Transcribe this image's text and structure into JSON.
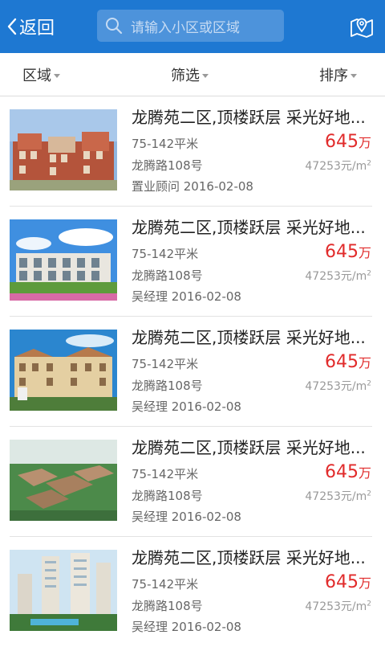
{
  "header": {
    "back_label": "返回",
    "search_placeholder": "请输入小区或区域"
  },
  "filters": [
    {
      "label": "区域"
    },
    {
      "label": "筛选"
    },
    {
      "label": "排序"
    }
  ],
  "listings": [
    {
      "title": "龙腾苑二区,顶楼跃层 采光好地...",
      "area": "75-142平米",
      "address": "龙腾路108号",
      "agent": "置业顾问 2016-02-08",
      "price": "645",
      "price_unit": "万",
      "unit_price": "47253元/m",
      "unit_price_sup": "2"
    },
    {
      "title": "龙腾苑二区,顶楼跃层 采光好地...",
      "area": "75-142平米",
      "address": "龙腾路108号",
      "agent": "吴经理 2016-02-08",
      "price": "645",
      "price_unit": "万",
      "unit_price": "47253元/m",
      "unit_price_sup": "2"
    },
    {
      "title": "龙腾苑二区,顶楼跃层 采光好地...",
      "area": "75-142平米",
      "address": "龙腾路108号",
      "agent": "吴经理 2016-02-08",
      "price": "645",
      "price_unit": "万",
      "unit_price": "47253元/m",
      "unit_price_sup": "2"
    },
    {
      "title": "龙腾苑二区,顶楼跃层 采光好地...",
      "area": "75-142平米",
      "address": "龙腾路108号",
      "agent": "吴经理 2016-02-08",
      "price": "645",
      "price_unit": "万",
      "unit_price": "47253元/m",
      "unit_price_sup": "2"
    },
    {
      "title": "龙腾苑二区,顶楼跃层 采光好地...",
      "area": "75-142平米",
      "address": "龙腾路108号",
      "agent": "吴经理 2016-02-08",
      "price": "645",
      "price_unit": "万",
      "unit_price": "47253元/m",
      "unit_price_sup": "2"
    }
  ],
  "colors": {
    "header_bg": "#1e78d2",
    "price": "#e12b2b"
  }
}
